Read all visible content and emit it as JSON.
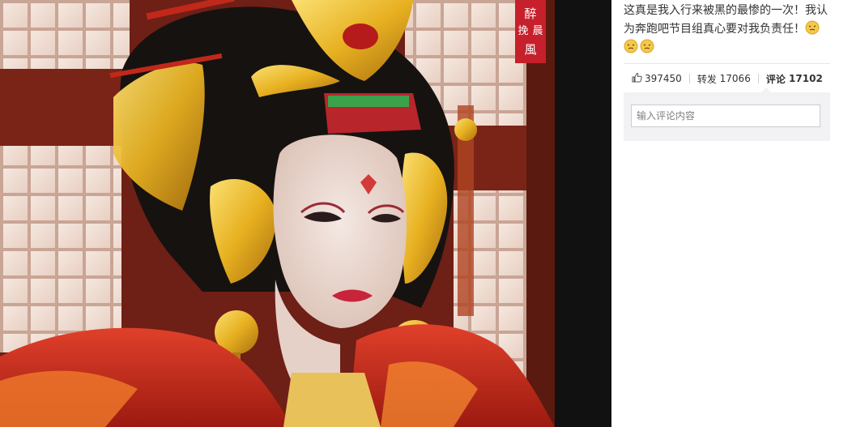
{
  "photo": {
    "watermark_text": "醉挽晨風",
    "colors": {
      "robe": "#c0281a",
      "gold": "#e7b020",
      "hair": "#161210",
      "lattice": "#f4e6dc"
    }
  },
  "post": {
    "text": "这真是我入行来被黑的最惨的一次！我认为奔跑吧节目组真心要对我负责任！",
    "emoji": [
      "face-emoji",
      "face-emoji",
      "face-emoji"
    ]
  },
  "actions": {
    "likes": "397450",
    "repost_label": "转发",
    "repost_count": "17066",
    "comment_label": "评论",
    "comment_count": "17102"
  },
  "comment": {
    "placeholder": "输入评论内容"
  }
}
